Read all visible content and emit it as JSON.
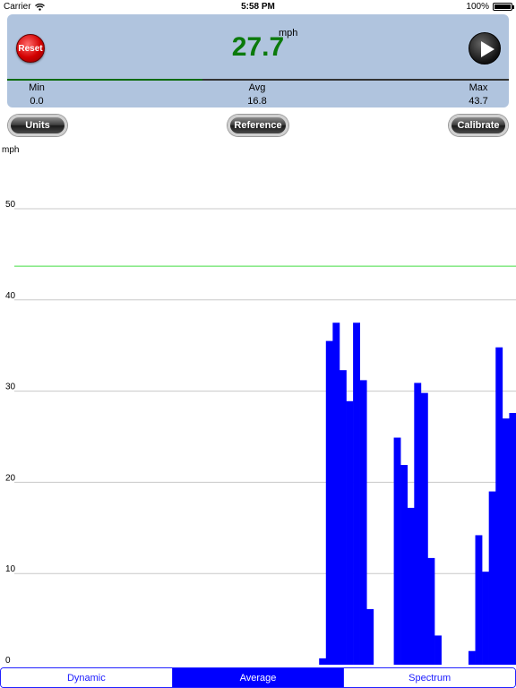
{
  "status": {
    "carrier": "Carrier",
    "time": "5:58 PM",
    "battery": "100%"
  },
  "meter": {
    "reset_label": "Reset",
    "speed": "27.7",
    "unit": "mph",
    "progress": 0.39,
    "stats": [
      {
        "label": "Min",
        "value": "0.0"
      },
      {
        "label": "Avg",
        "value": "16.8"
      },
      {
        "label": "Max",
        "value": "43.7"
      }
    ]
  },
  "buttons": {
    "units": "Units",
    "reference": "Reference",
    "calibrate": "Calibrate"
  },
  "chart_data": {
    "type": "bar",
    "ylabel": "mph",
    "ylim": [
      0,
      54
    ],
    "yticks": [
      0,
      10,
      20,
      30,
      40,
      50
    ],
    "reference_line": 43.7,
    "bar_color": "#0000ff",
    "reference_color": "#44dd44",
    "x_range": [
      0,
      76
    ],
    "bars": [
      {
        "x": 47,
        "y": 0.7
      },
      {
        "x": 48,
        "y": 35.5
      },
      {
        "x": 49,
        "y": 37.5
      },
      {
        "x": 50,
        "y": 32.3
      },
      {
        "x": 51,
        "y": 28.9
      },
      {
        "x": 52,
        "y": 37.5
      },
      {
        "x": 53,
        "y": 31.2
      },
      {
        "x": 54,
        "y": 6.1
      },
      {
        "x": 58,
        "y": 24.9
      },
      {
        "x": 59,
        "y": 21.9
      },
      {
        "x": 60,
        "y": 17.2
      },
      {
        "x": 61,
        "y": 30.9
      },
      {
        "x": 62,
        "y": 29.8
      },
      {
        "x": 63,
        "y": 11.7
      },
      {
        "x": 64,
        "y": 3.2
      },
      {
        "x": 69,
        "y": 1.5
      },
      {
        "x": 70,
        "y": 14.2
      },
      {
        "x": 71,
        "y": 10.2
      },
      {
        "x": 72,
        "y": 19.0
      },
      {
        "x": 73,
        "y": 34.8
      },
      {
        "x": 74,
        "y": 27.0
      },
      {
        "x": 75,
        "y": 27.6
      }
    ]
  },
  "tabs": [
    {
      "label": "Dynamic",
      "active": false
    },
    {
      "label": "Average",
      "active": true
    },
    {
      "label": "Spectrum",
      "active": false
    }
  ]
}
